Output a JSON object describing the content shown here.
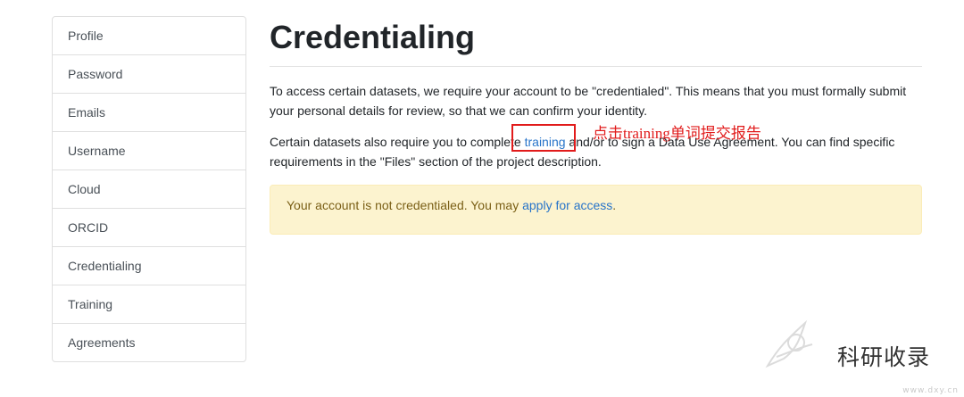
{
  "sidebar": {
    "items": [
      {
        "label": "Profile"
      },
      {
        "label": "Password"
      },
      {
        "label": "Emails"
      },
      {
        "label": "Username"
      },
      {
        "label": "Cloud"
      },
      {
        "label": "ORCID"
      },
      {
        "label": "Credentialing"
      },
      {
        "label": "Training"
      },
      {
        "label": "Agreements"
      }
    ]
  },
  "main": {
    "title": "Credentialing",
    "intro": "To access certain datasets, we require your account to be \"credentialed\". This means that you must formally submit your personal details for review, so that we can confirm your identity.",
    "para2_before": "Certain datasets also require you to complete ",
    "para2_link": "training",
    "para2_after": " and/or to sign a Data Use Agreement. You can find specific requirements in the \"Files\" section of the project description.",
    "alert_text": "Your account is not credentialed. You may ",
    "alert_link": "apply for access",
    "alert_end": "."
  },
  "annotation": {
    "text": "点击training单词提交报告",
    "color": "#e11b1b"
  },
  "watermark": {
    "text": "科研收录",
    "site": "www.dxy.cn"
  },
  "colors": {
    "link": "#2874c9",
    "alert_bg": "#fcf3cf",
    "alert_text": "#7a5f16",
    "annotation": "#e11b1b"
  }
}
